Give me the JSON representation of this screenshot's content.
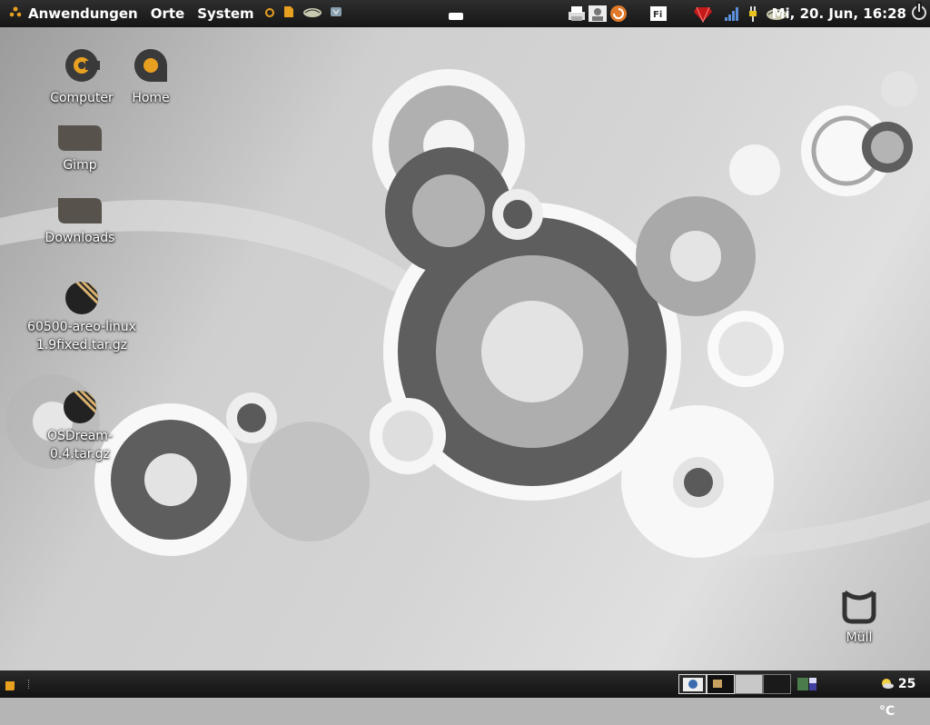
{
  "top_panel": {
    "menus": {
      "applications": "Anwendungen",
      "places": "Orte",
      "system": "System"
    },
    "clock": "Mi, 20. Jun, 16:28"
  },
  "desktop": {
    "icons": [
      {
        "label": "Computer",
        "icon": "computer-icon"
      },
      {
        "label": "Home",
        "icon": "home-folder-icon"
      },
      {
        "label": "Gimp",
        "icon": "folder-icon"
      },
      {
        "label": "Downloads",
        "icon": "folder-icon"
      },
      {
        "label": "60500-areo-linux1.9fixed.tar.gz",
        "icon": "archive-icon"
      },
      {
        "label": "OSDream-0.4.tar.gz",
        "icon": "archive-icon"
      },
      {
        "label": "Müll",
        "icon": "trash-icon"
      }
    ]
  },
  "bottom_panel": {
    "weather": "25 °C"
  },
  "colors": {
    "panel": "#1b1b1b",
    "accent": "#e8a020",
    "icon_dark": "#3a3a3a"
  }
}
